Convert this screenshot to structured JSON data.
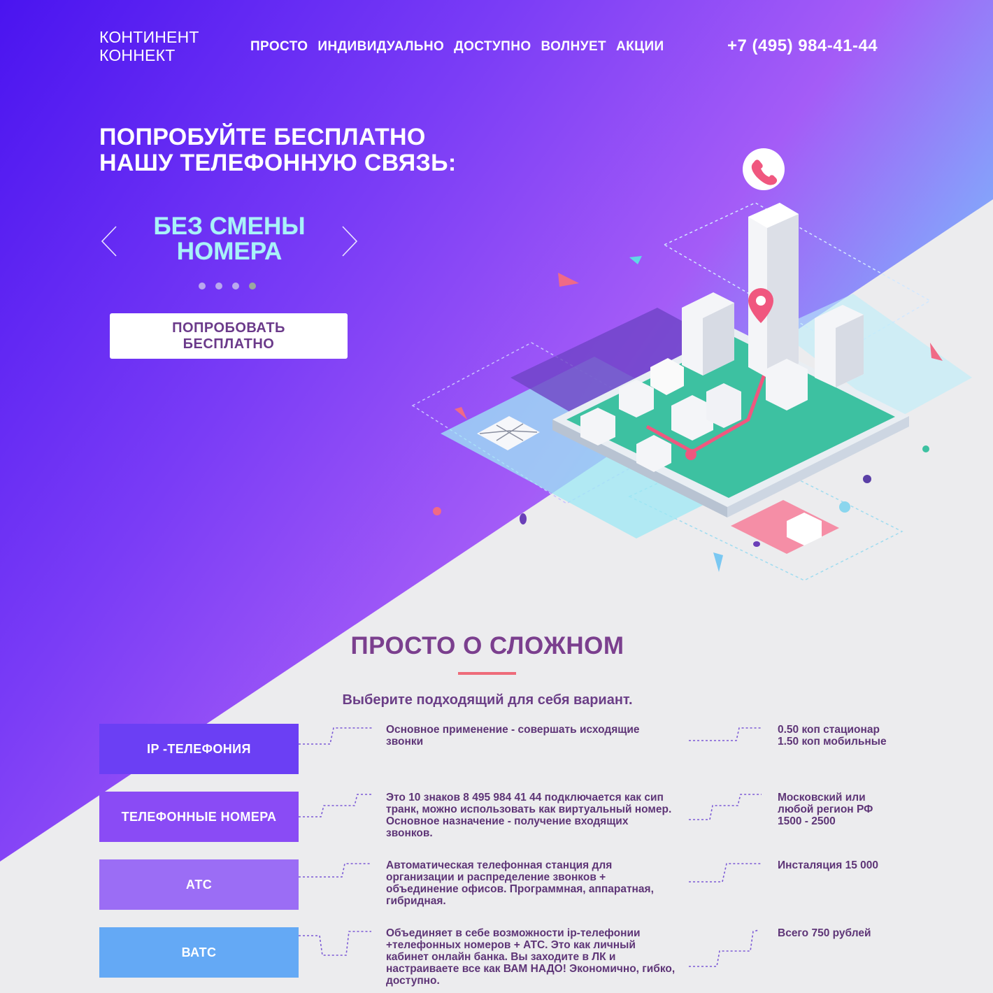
{
  "brand": {
    "line1": "КОНТИНЕНТ",
    "line2": "КОННЕКТ"
  },
  "nav": {
    "items": [
      "ПРОСТО",
      "ИНДИВИДУАЛЬНО",
      "ДОСТУПНО",
      "ВОЛНУЕТ",
      "АКЦИИ"
    ]
  },
  "phone": "+7 (495) 984-41-44",
  "hero": {
    "title_line1": "ПОПРОБУЙТЕ  БЕСПЛАТНО",
    "title_line2": "НАШУ ТЕЛЕФОННУЮ СВЯЗЬ:",
    "slide_line1": "БЕЗ СМЕНЫ",
    "slide_line2": "НОМЕРА",
    "slide_count": 4,
    "active_slide": 4,
    "cta_line1": "ПОПРОБОВАТЬ",
    "cta_line2": "БЕСПЛАТНО"
  },
  "section": {
    "title": "ПРОСТО О СЛОЖНОМ",
    "subtitle": "Выберите подходящий для себя вариант."
  },
  "services": [
    {
      "label": "IP -ТЕЛЕФОНИЯ",
      "color": "#6b3ff4",
      "description": [
        "Основное применение - совершать исходящие",
        "звонки"
      ],
      "price": [
        "0.50 коп стационар",
        "1.50 коп мобильные"
      ]
    },
    {
      "label": "ТЕЛЕФОННЫЕ НОМЕРА",
      "color": "#8a4bf5",
      "description": [
        "Это 10 знаков 8 495 984 41 44 подключается как сип",
        "транк, можно использовать как виртуальный номер.",
        "Основное назначение - получение входящих",
        "звонков."
      ],
      "price": [
        "Московский или",
        "любой регион РФ",
        "1500 - 2500"
      ]
    },
    {
      "label": "АТС",
      "color": "#9b6df5",
      "description": [
        "Автоматическая телефонная станция для",
        "организации и распределение звонков +",
        "объединение офисов. Программная, аппаратная,",
        "гибридная."
      ],
      "price": [
        "Инсталяция 15 000"
      ]
    },
    {
      "label": "ВАТС",
      "color": "#64a9f5",
      "description": [
        "Объединяет в себе возможности ip-телефонии",
        "+телефонных номеров + АТС. Это как личный",
        "кабинет онлайн банка. Вы заходите в ЛК и",
        "настраиваете все как ВАМ НАДО! Экономично, гибко,",
        "доступно."
      ],
      "price": [
        "Всего 750 рублей"
      ]
    }
  ],
  "icons": {
    "prev": "chevron-left-icon",
    "next": "chevron-right-icon",
    "phone_badge": "phone-incoming-icon",
    "map_pin": "map-pin-icon",
    "mail": "mail-icon"
  }
}
